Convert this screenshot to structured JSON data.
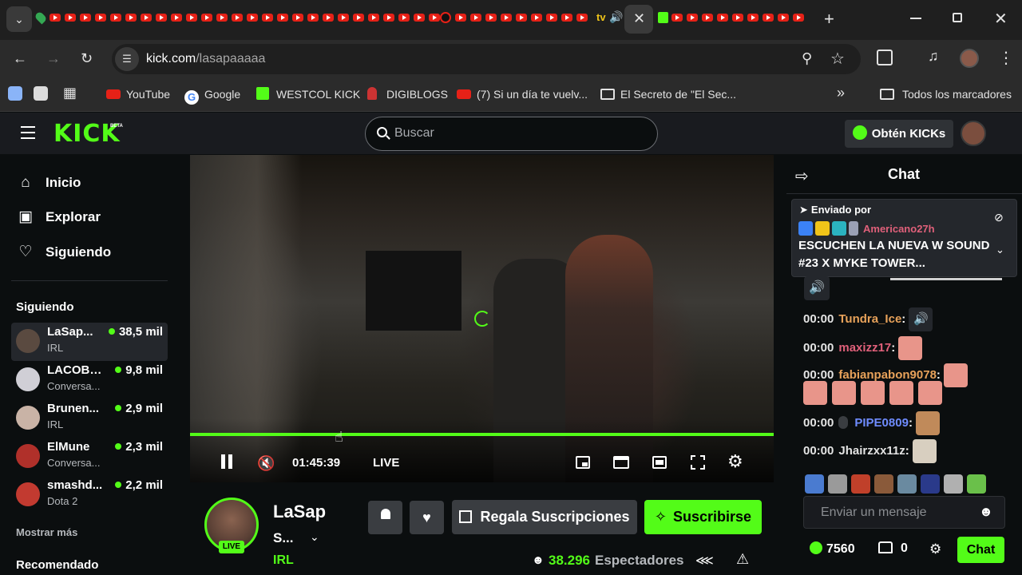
{
  "browser": {
    "url_domain": "kick.com",
    "url_path": "/lasapaaaaa",
    "tab_tv_label": "tv",
    "bookmarks": [
      {
        "label": "YouTube"
      },
      {
        "label": "Google"
      },
      {
        "label": "WESTCOL KICK"
      },
      {
        "label": "DIGIBLOGS"
      },
      {
        "label": "(7) Si un día te vuelv..."
      },
      {
        "label": "El Secreto de \"El Sec..."
      }
    ],
    "all_bookmarks": "Todos los marcadores"
  },
  "site": {
    "logo": "KICK",
    "logo_badge": "BETA",
    "search_placeholder": "Buscar",
    "get_kicks": "Obtén KICKs"
  },
  "sidebar": {
    "nav": [
      {
        "label": "Inicio",
        "icon": "home-icon"
      },
      {
        "label": "Explorar",
        "icon": "explore-icon"
      },
      {
        "label": "Siguiendo",
        "icon": "heart-icon"
      }
    ],
    "following_title": "Siguiendo",
    "following": [
      {
        "name": "LaSap...",
        "category": "IRL",
        "viewers": "38,5 mil"
      },
      {
        "name": "LACOBR...",
        "category": "Conversa...",
        "viewers": "9,8 mil"
      },
      {
        "name": "Brunen...",
        "category": "IRL",
        "viewers": "2,9 mil"
      },
      {
        "name": "ElMune",
        "category": "Conversa...",
        "viewers": "2,3 mil"
      },
      {
        "name": "smashd...",
        "category": "Dota 2",
        "viewers": "2,2 mil"
      }
    ],
    "show_more": "Mostrar más",
    "recommended_title": "Recomendado"
  },
  "player": {
    "time": "01:45:39",
    "live_label": "LIVE",
    "progress": 1.0
  },
  "channel": {
    "name": "LaSap",
    "title": "S...",
    "category": "IRL",
    "live_badge": "LIVE",
    "gift_subs": "Regala Suscripciones",
    "subscribe": "Suscribirse",
    "viewers_count": "38.296",
    "viewers_label": "Espectadores"
  },
  "chat": {
    "title": "Chat",
    "pinned_label": "Enviado por",
    "pinned_user": "Americano27h",
    "pinned_text": "ESCUCHEN LA NUEVA W SOUND #23 X MYKE TOWER...",
    "messages": [
      {
        "time": "00:00",
        "user": "Tundra_Ice",
        "color": "#e8a25a"
      },
      {
        "time": "00:00",
        "user": "maxizz17",
        "color": "#e0607a"
      },
      {
        "time": "00:00",
        "user": "fabianpabon9078",
        "color": "#e8a25a"
      },
      {
        "time": "00:00",
        "user": "PIPE0809",
        "color": "#6f8cff"
      },
      {
        "time": "00:00",
        "user": "Jhairzxx11z",
        "color": "#e3e3e3"
      }
    ],
    "input_placeholder": "Enviar un mensaje",
    "kicks_balance": "7560",
    "drops_count": "0",
    "chat_button": "Chat"
  },
  "colors": {
    "accent": "#53fc18",
    "bg": "#0b0e0f",
    "bar": "#191b1f"
  }
}
